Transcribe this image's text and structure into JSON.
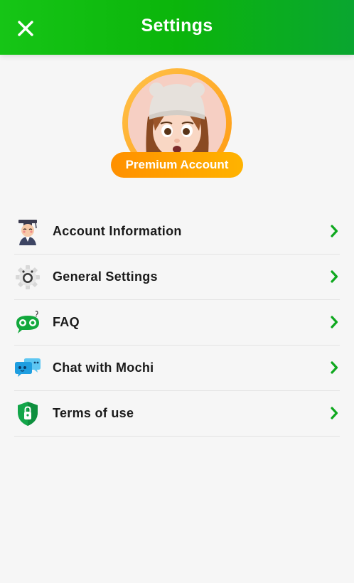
{
  "header": {
    "title": "Settings",
    "close_icon": "close-icon",
    "background_color": "#0bb50b"
  },
  "profile": {
    "avatar_icon": "user-avatar",
    "badge_label": "Premium Account",
    "badge_color": "#ff9f00"
  },
  "menu": {
    "items": [
      {
        "label": "Account Information",
        "icon": "account-info-icon"
      },
      {
        "label": "General Settings",
        "icon": "gear-icon"
      },
      {
        "label": "FAQ",
        "icon": "faq-chat-icon"
      },
      {
        "label": "Chat with Mochi",
        "icon": "chat-bubbles-icon"
      },
      {
        "label": "Terms of use",
        "icon": "shield-lock-icon"
      }
    ],
    "chevron_color": "#0fa81f"
  }
}
